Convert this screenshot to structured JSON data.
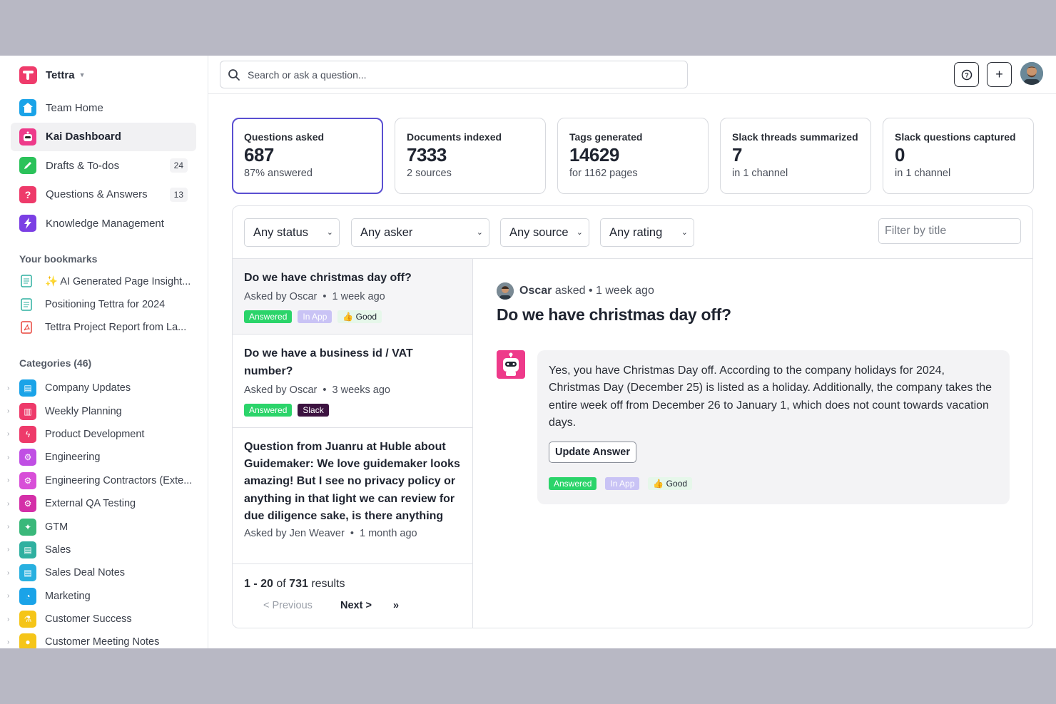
{
  "workspace": {
    "name": "Tettra"
  },
  "nav": [
    {
      "label": "Team Home",
      "icon": "home-icon",
      "color": "#1aa3e8"
    },
    {
      "label": "Kai Dashboard",
      "icon": "robot-icon",
      "color": "#ee3a8a",
      "active": true
    },
    {
      "label": "Drafts & To-dos",
      "icon": "pencil-icon",
      "color": "#2bc25a",
      "count": "24"
    },
    {
      "label": "Questions & Answers",
      "icon": "question-icon",
      "color": "#ee3a6a",
      "count": "13"
    },
    {
      "label": "Knowledge Management",
      "icon": "lightning-icon",
      "color": "#7b3fe4"
    }
  ],
  "bookmarks": {
    "title": "Your bookmarks",
    "items": [
      {
        "label": "✨ AI Generated Page Insight...",
        "icon": "document-icon"
      },
      {
        "label": "Positioning Tettra for 2024",
        "icon": "document-icon"
      },
      {
        "label": "Tettra Project Report from La...",
        "icon": "pdf-icon"
      }
    ]
  },
  "categories": {
    "title": "Categories (46)",
    "items": [
      {
        "label": "Company Updates",
        "color": "#1aa3e8"
      },
      {
        "label": "Weekly Planning",
        "color": "#ee3a6a"
      },
      {
        "label": "Product Development",
        "color": "#ee3a6a"
      },
      {
        "label": "Engineering",
        "color": "#c04fe4"
      },
      {
        "label": "Engineering Contractors (Exte...",
        "color": "#d84fd8"
      },
      {
        "label": "External QA Testing",
        "color": "#d42fa8"
      },
      {
        "label": "GTM",
        "color": "#3ab87a"
      },
      {
        "label": "Sales",
        "color": "#2fb0a0"
      },
      {
        "label": "Sales Deal Notes",
        "color": "#28b0e0"
      },
      {
        "label": "Marketing",
        "color": "#1aa3e8"
      },
      {
        "label": "Customer Success",
        "color": "#f5c518"
      },
      {
        "label": "Customer Meeting Notes",
        "color": "#f5c518"
      }
    ]
  },
  "search": {
    "placeholder": "Search or ask a question..."
  },
  "stats": [
    {
      "label": "Questions asked",
      "value": "687",
      "sub": "87% answered"
    },
    {
      "label": "Documents indexed",
      "value": "7333",
      "sub": "2 sources"
    },
    {
      "label": "Tags generated",
      "value": "14629",
      "sub": "for 1162 pages"
    },
    {
      "label": "Slack threads summarized",
      "value": "7",
      "sub": "in 1 channel"
    },
    {
      "label": "Slack questions captured",
      "value": "0",
      "sub": "in 1 channel"
    }
  ],
  "filters": {
    "status": "Any status",
    "asker": "Any asker",
    "source": "Any source",
    "rating": "Any rating",
    "title_placeholder": "Filter by title"
  },
  "questions": [
    {
      "title": "Do we have christmas day off?",
      "asker": "Asked by Oscar",
      "time": "1 week ago",
      "tags": [
        "Answered",
        "In App",
        "👍 Good"
      ]
    },
    {
      "title": "Do we have a business id / VAT number?",
      "asker": "Asked by Oscar",
      "time": "3 weeks ago",
      "tags": [
        "Answered",
        "Slack"
      ]
    },
    {
      "title": "Question from Juanru at Huble about Guidemaker: We love guidemaker looks amazing! But I see no privacy policy or anything in that light we can review for due diligence sake, is there anything",
      "asker": "Asked by Jen Weaver",
      "time": "1 month ago"
    }
  ],
  "pager": {
    "range": "1 - 20",
    "of": "of",
    "total": "731",
    "suffix": "results",
    "prev": "< Previous",
    "next": "Next >",
    "last": "»"
  },
  "detail": {
    "asker_name": "Oscar",
    "asked_text": "asked • 1 week ago",
    "title": "Do we have christmas day off?",
    "answer": "Yes, you have Christmas Day off. According to the company holidays for 2024, Christmas Day (December 25) is listed as a holiday. Additionally, the company takes the entire week off from December 26 to January 1, which does not count towards vacation days.",
    "update_label": "Update Answer",
    "tags": [
      "Answered",
      "In App",
      "👍 Good"
    ]
  },
  "colors": {
    "accent": "#5a4fd1",
    "answered": "#2bd46a",
    "inapp": "#c9c3f5",
    "slack": "#3c1340"
  }
}
